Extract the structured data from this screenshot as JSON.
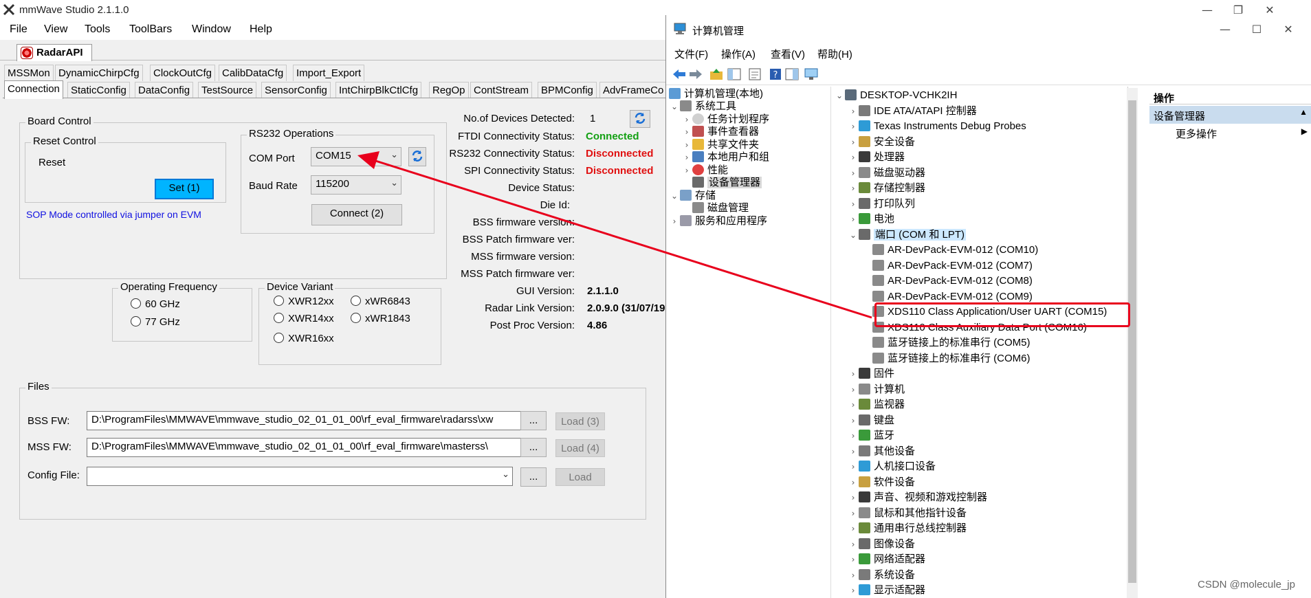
{
  "mmwave": {
    "window_title": "mmWave Studio 2.1.1.0",
    "menu": [
      "File",
      "View",
      "Tools",
      "ToolBars",
      "Window",
      "Help"
    ],
    "radar_tab": "RadarAPI",
    "tabs_row1": [
      "MSSMon",
      "DynamicChirpCfg",
      "ClockOutCfg",
      "CalibDataCfg",
      "Import_Export"
    ],
    "tabs_row2": [
      "Connection",
      "StaticConfig",
      "DataConfig",
      "TestSource",
      "SensorConfig",
      "IntChirpBlkCtlCfg",
      "RegOp",
      "ContStream",
      "BPMConfig",
      "AdvFrameCo"
    ],
    "board_control": {
      "caption": "Board Control",
      "reset_control": "Reset Control",
      "reset_label": "Reset",
      "set_button": "Set (1)",
      "sop_note": "SOP Mode controlled via jumper on EVM"
    },
    "rs232": {
      "caption": "RS232 Operations",
      "com_port_label": "COM Port",
      "com_port_value": "COM15",
      "baud_rate_label": "Baud Rate",
      "baud_rate_value": "115200",
      "connect_button": "Connect (2)"
    },
    "status": {
      "devices_label": "No.of Devices Detected:",
      "devices_value": "1",
      "ftdi_label": "FTDI Connectivity Status:",
      "ftdi_value": "Connected",
      "rs232_label": "RS232 Connectivity Status:",
      "rs232_value": "Disconnected",
      "spi_label": "SPI Connectivity Status:",
      "spi_value": "Disconnected",
      "device_status_label": "Device Status:",
      "die_id_label": "Die Id:",
      "bss_fw_label": "BSS firmware version:",
      "bss_patch_label": "BSS Patch firmware ver:",
      "mss_fw_label": "MSS firmware version:",
      "mss_patch_label": "MSS Patch firmware ver:",
      "gui_label": "GUI Version:",
      "gui_value": "2.1.1.0",
      "radar_link_label": "Radar Link Version:",
      "radar_link_value": "2.0.9.0 (31/07/19",
      "post_proc_label": "Post Proc Version:",
      "post_proc_value": "4.86"
    },
    "op_freq": {
      "caption": "Operating Frequency",
      "opt1": "60 GHz",
      "opt2": "77 GHz"
    },
    "device_variant": {
      "caption": "Device Variant",
      "opt1": "XWR12xx",
      "opt2": "xWR6843",
      "opt3": "XWR14xx",
      "opt4": "xWR1843",
      "opt5": "XWR16xx"
    },
    "files": {
      "caption": "Files",
      "bss_label": "BSS FW:",
      "bss_path": "D:\\ProgramFiles\\MMWAVE\\mmwave_studio_02_01_01_00\\rf_eval_firmware\\radarss\\xw",
      "bss_load": "Load (3)",
      "mss_label": "MSS FW:",
      "mss_path": "D:\\ProgramFiles\\MMWAVE\\mmwave_studio_02_01_01_00\\rf_eval_firmware\\masterss\\",
      "mss_load": "Load (4)",
      "config_label": "Config File:",
      "config_path": "",
      "config_load": "Load",
      "browse": "..."
    }
  },
  "compmgmt": {
    "window_title": "计算机管理",
    "menu": [
      "文件(F)",
      "操作(A)",
      "查看(V)",
      "帮助(H)"
    ],
    "left_tree": {
      "root": "计算机管理(本地)",
      "system_tools": "系统工具",
      "task_scheduler": "任务计划程序",
      "event_viewer": "事件查看器",
      "shared_folders": "共享文件夹",
      "local_users": "本地用户和组",
      "performance": "性能",
      "device_manager": "设备管理器",
      "storage": "存储",
      "disk_management": "磁盘管理",
      "services": "服务和应用程序"
    },
    "device_tree": {
      "computer": "DESKTOP-VCHK2IH",
      "categories": [
        "IDE ATA/ATAPI 控制器",
        "Texas Instruments Debug Probes",
        "安全设备",
        "处理器",
        "磁盘驱动器",
        "存储控制器",
        "打印队列",
        "电池"
      ],
      "ports": "端口 (COM 和 LPT)",
      "port_items": [
        "AR-DevPack-EVM-012 (COM10)",
        "AR-DevPack-EVM-012 (COM7)",
        "AR-DevPack-EVM-012 (COM8)",
        "AR-DevPack-EVM-012 (COM9)",
        "XDS110 Class Application/User UART (COM15)",
        "XDS110 Class Auxiliary Data Port (COM16)",
        "蓝牙链接上的标准串行 (COM5)",
        "蓝牙链接上的标准串行 (COM6)"
      ],
      "categories_after": [
        "固件",
        "计算机",
        "监视器",
        "键盘",
        "蓝牙",
        "其他设备",
        "人机接口设备",
        "软件设备",
        "声音、视频和游戏控制器",
        "鼠标和其他指针设备",
        "通用串行总线控制器",
        "图像设备",
        "网络适配器",
        "系统设备",
        "显示适配器"
      ]
    },
    "actions": {
      "header": "操作",
      "section": "设备管理器",
      "more": "更多操作"
    }
  },
  "watermark": "CSDN @molecule_jp",
  "colors": {
    "annotation_red": "#e8001c",
    "set_button_blue": "#00b4ff",
    "connected_green": "#12a012",
    "disconnected_red": "#e01010"
  }
}
